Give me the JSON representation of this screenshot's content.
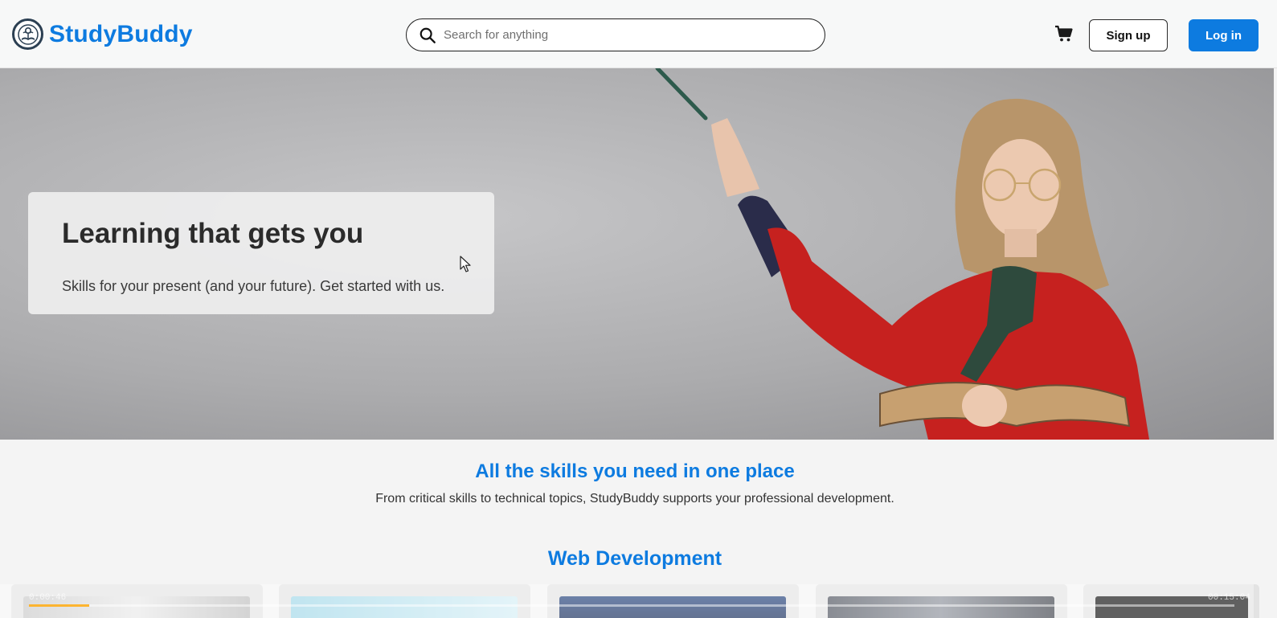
{
  "brand": {
    "name": "StudyBuddy",
    "logo_icon": "tree-book-logo-icon"
  },
  "header": {
    "search": {
      "placeholder": "Search for anything",
      "value": ""
    },
    "cart_icon": "cart-icon",
    "signup_label": "Sign up",
    "login_label": "Log in"
  },
  "hero": {
    "title": "Learning that gets you",
    "subtitle": "Skills for your present (and your future). Get started with us."
  },
  "skills": {
    "title": "All the skills you need in one place",
    "subtitle": "From critical skills to technical topics, StudyBuddy supports your professional development."
  },
  "category": {
    "title": "Web Development"
  },
  "video": {
    "elapsed": "0:00:46",
    "duration": "00:15:04",
    "progress_fraction": 0.05
  },
  "colors": {
    "accent": "#0d7be0",
    "header_bg": "#f7f8f8",
    "page_bg": "#f4f4f4"
  }
}
